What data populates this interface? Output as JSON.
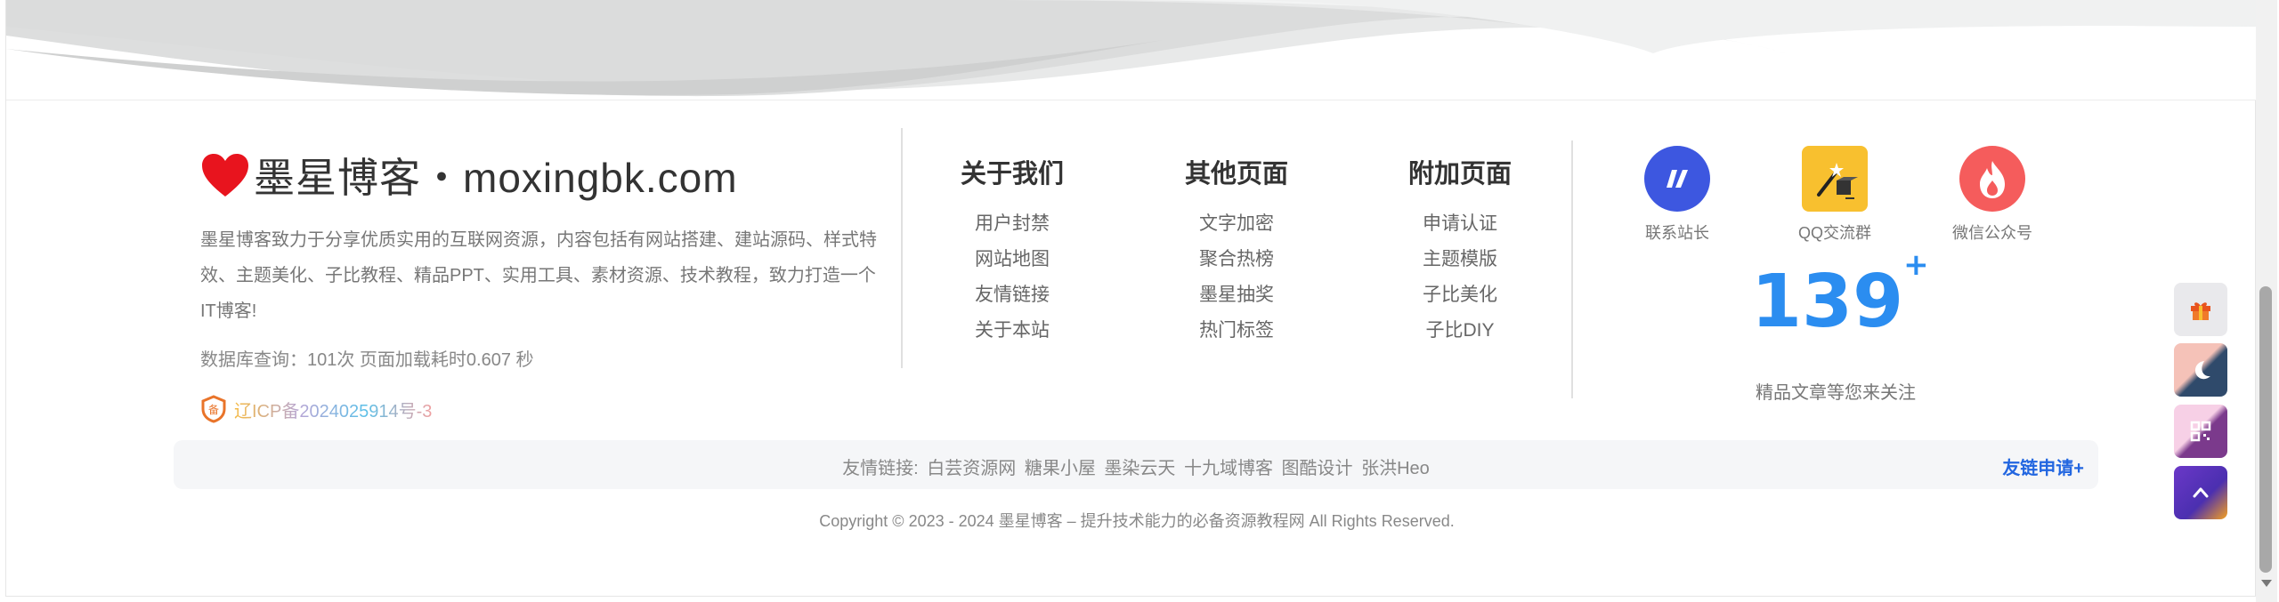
{
  "brand": {
    "title": "墨星博客・moxingbk.com",
    "description": "墨星博客致力于分享优质实用的互联网资源，内容包括有网站搭建、建站源码、样式特效、主题美化、子比教程、精品PPT、实用工具、素材资源、技术教程，致力打造一个IT博客!",
    "db_info": "数据库查询：101次 页面加载耗时0.607 秒",
    "icp": "辽ICP备2024025914号-3"
  },
  "columns": [
    {
      "title": "关于我们",
      "links": [
        "用户封禁",
        "网站地图",
        "友情链接",
        "关于本站"
      ]
    },
    {
      "title": "其他页面",
      "links": [
        "文字加密",
        "聚合热榜",
        "墨星抽奖",
        "热门标签"
      ]
    },
    {
      "title": "附加页面",
      "links": [
        "申请认证",
        "主题模版",
        "子比美化",
        "子比DIY"
      ]
    }
  ],
  "social": [
    {
      "label": "联系站长",
      "icon": "contact-icon"
    },
    {
      "label": "QQ交流群",
      "icon": "qq-group-icon"
    },
    {
      "label": "微信公众号",
      "icon": "wechat-icon"
    }
  ],
  "stats": {
    "count": "139",
    "suffix": "+",
    "label": "精品文章等您来关注"
  },
  "friend_links": {
    "prefix": "友情链接:",
    "items": [
      "白芸资源网",
      "糖果小屋",
      "墨染云天",
      "十九域博客",
      "图酷设计",
      "张洪Heo"
    ],
    "apply": "友链申请+"
  },
  "copyright": "Copyright © 2023 - 2024 墨星博客 – 提升技术能力的必备资源教程网 All Rights Reserved.",
  "float_buttons": [
    "gift-icon",
    "moon-icon",
    "qrcode-icon",
    "back-to-top-icon"
  ],
  "colors": {
    "accent": "#2b8df0",
    "link_blue": "#2266e0",
    "heart": "#e8141e"
  }
}
